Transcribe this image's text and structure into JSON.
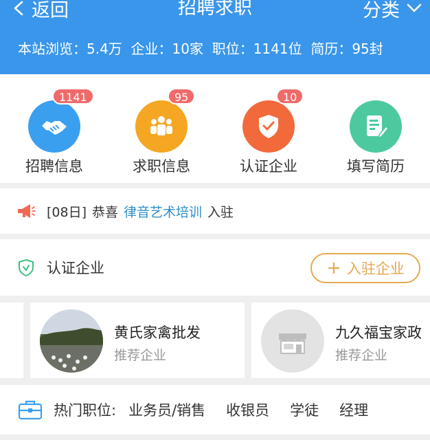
{
  "header": {
    "back_label": "返回",
    "title": "招聘求职",
    "category_label": "分类",
    "stats": [
      {
        "label": "本站浏览：",
        "value": "5.4万"
      },
      {
        "label": "企业：",
        "value": "10家"
      },
      {
        "label": "职位：",
        "value": "1141位"
      },
      {
        "label": "简历：",
        "value": "95封"
      }
    ]
  },
  "quick": [
    {
      "label": "招聘信息",
      "badge": "1141",
      "color": "#3b9ff0",
      "icon": "handshake-icon"
    },
    {
      "label": "求职信息",
      "badge": "95",
      "color": "#f5a623",
      "icon": "people-icon"
    },
    {
      "label": "认证企业",
      "badge": "10",
      "color": "#f26a3c",
      "icon": "shield-check-icon"
    },
    {
      "label": "填写简历",
      "badge": "",
      "color": "#4dc9a0",
      "icon": "document-edit-icon"
    }
  ],
  "notice": {
    "date": "[08日]",
    "prefix": "恭喜",
    "company": "律音艺术培训",
    "suffix": "入驻"
  },
  "cert": {
    "title": "认证企业",
    "join_label": "入驻企业"
  },
  "companies": [
    {
      "name": "黄氏家禽批发",
      "tag": "推荐企业"
    },
    {
      "name": "九久福宝家政",
      "tag": "推荐企业"
    }
  ],
  "hot_jobs": {
    "label": "热门职位:",
    "jobs": [
      "业务员/销售",
      "收银员",
      "学徒",
      "经理"
    ]
  },
  "colors": {
    "header_bg": "#3a96ea",
    "highlight": "#2e8ec9",
    "accent_orange": "#e5a850",
    "badge_red": "#f06a6a"
  }
}
